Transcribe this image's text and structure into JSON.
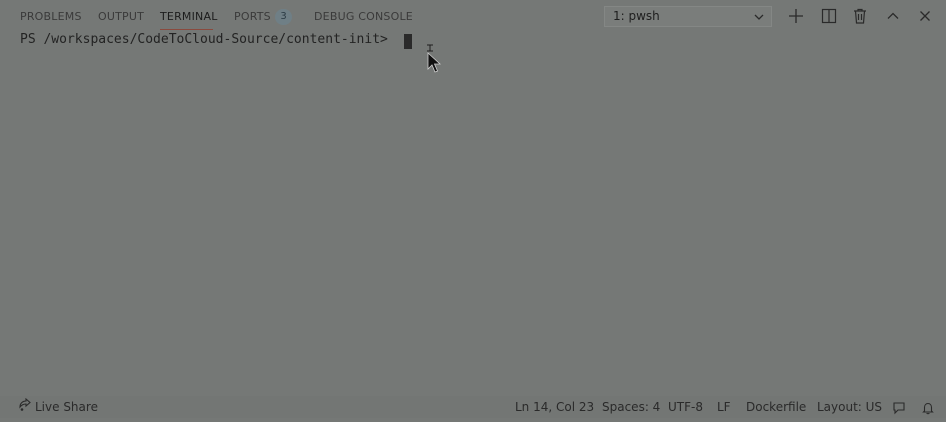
{
  "panel": {
    "tabs": [
      {
        "label": "PROBLEMS"
      },
      {
        "label": "OUTPUT"
      },
      {
        "label": "TERMINAL"
      },
      {
        "label": "PORTS"
      },
      {
        "label": "DEBUG CONSOLE"
      }
    ],
    "ports_badge": "3",
    "active_tab": "TERMINAL",
    "terminal_select": "1: pwsh",
    "actions": [
      "plus-icon",
      "split-icon",
      "trash-icon",
      "chevron-up-icon",
      "close-icon"
    ]
  },
  "terminal": {
    "prompt": "PS /workspaces/CodeToCloud-Source/content-init> "
  },
  "status_bar": {
    "live_share": "Live Share",
    "position": "Ln 14, Col 23",
    "spaces": "Spaces: 4",
    "encoding": "UTF-8",
    "eol": "LF",
    "language": "Dockerfile",
    "layout": "Layout: US"
  },
  "colors": {
    "background": "#757876",
    "active_underline": "#8a4a3e",
    "badge_bg": "#6f7f86"
  }
}
